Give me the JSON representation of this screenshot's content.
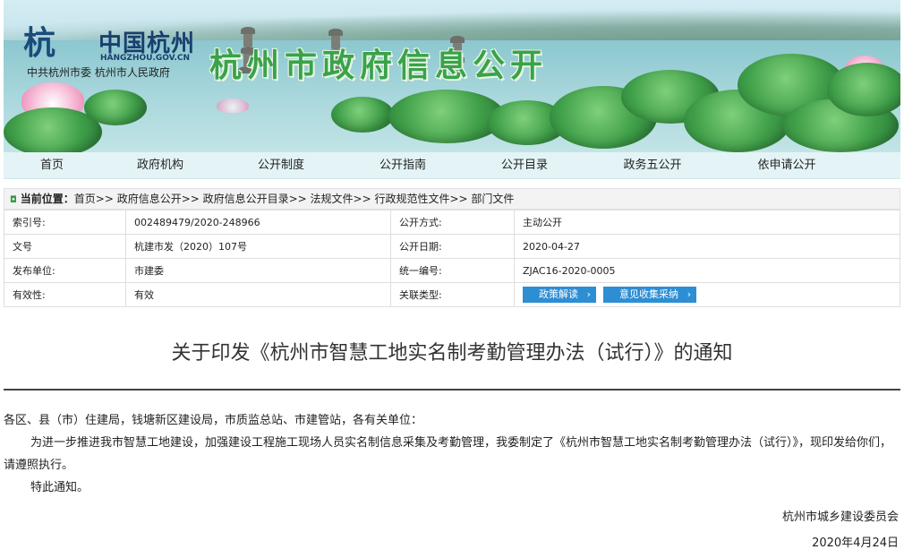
{
  "banner": {
    "logo_text": "中国杭州",
    "logo_domain": "HANGZHOU.GOV.CN",
    "logo_sub": "中共杭州市委  杭州市人民政府",
    "site_title": "杭州市政府信息公开"
  },
  "nav": [
    "首页",
    "政府机构",
    "公开制度",
    "公开指南",
    "公开目录",
    "政务五公开",
    "依申请公开"
  ],
  "breadcrumb": {
    "label": "当前位置：",
    "path": "首页>> 政府信息公开>> 政府信息公开目录>> 法规文件>> 行政规范性文件>> 部门文件"
  },
  "info": {
    "index_no_label": "索引号:",
    "index_no": "002489479/2020-248966",
    "mode_label": "公开方式:",
    "mode": "主动公开",
    "doc_no_label": "文号",
    "doc_no": "杭建市发（2020）107号",
    "date_label": "公开日期:",
    "date": "2020-04-27",
    "issuer_label": "发布单位:",
    "issuer": "市建委",
    "unified_label": "统一编号:",
    "unified": "ZJAC16-2020-0005",
    "validity_label": "有效性:",
    "validity": "有效",
    "related_label": "关联类型:",
    "btn_interpret": "政策解读",
    "btn_feedback": "意见收集采纳"
  },
  "doc": {
    "title": "关于印发《杭州市智慧工地实名制考勤管理办法（试行）》的通知",
    "salutation": "各区、县（市）住建局，钱塘新区建设局，市质监总站、市建管站，各有关单位：",
    "para1": "为进一步推进我市智慧工地建设，加强建设工程施工现场人员实名制信息采集及考勤管理，我委制定了《杭州市智慧工地实名制考勤管理办法（试行）》，现印发给你们，请遵照执行。",
    "para2": "特此通知。",
    "signer": "杭州市城乡建设委员会",
    "sign_date": "2020年4月24日"
  }
}
